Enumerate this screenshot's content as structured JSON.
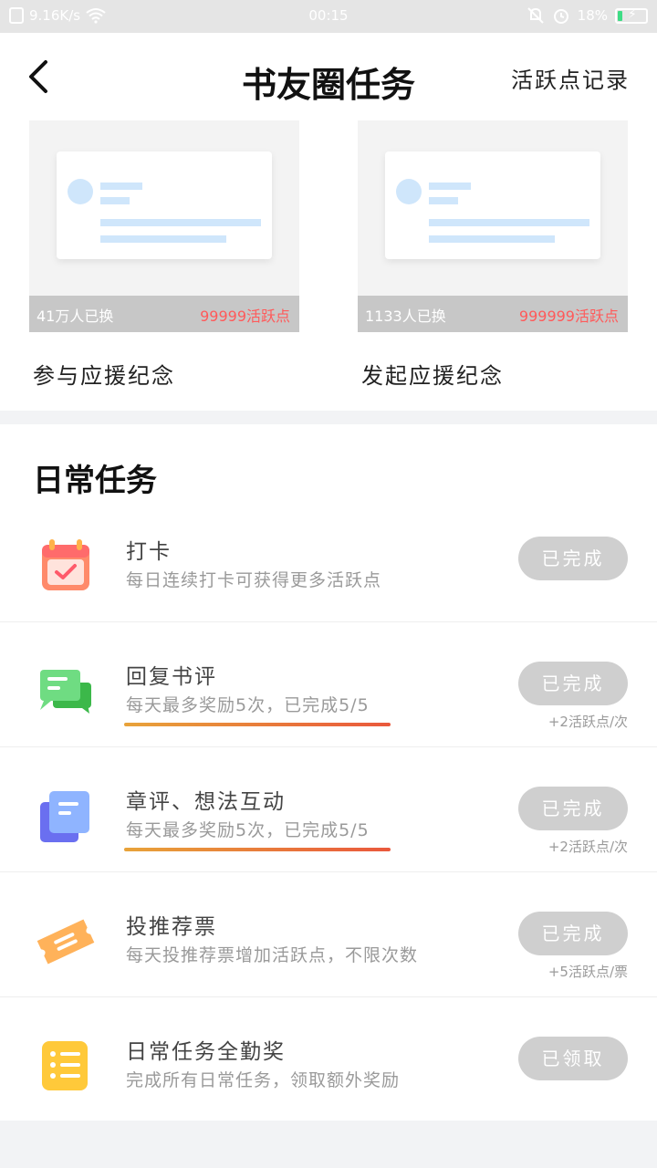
{
  "status_bar": {
    "net_speed": "9.16K/s",
    "time": "00:15",
    "battery": "18%",
    "battery_level": 0.18,
    "icons": [
      "sim-icon",
      "wifi-icon",
      "mute-icon",
      "alarm-icon",
      "battery-icon"
    ]
  },
  "header": {
    "title": "书友圈任务",
    "right_link": "活跃点记录"
  },
  "badges": [
    {
      "count": "41万人已换",
      "price": "99999活跃点",
      "name": "参与应援纪念"
    },
    {
      "count": "1133人已换",
      "price": "999999活跃点",
      "name": "发起应援纪念"
    }
  ],
  "daily": {
    "title": "日常任务",
    "tasks": [
      {
        "icon": "calendar-check-icon",
        "title": "打卡",
        "desc": "每日连续打卡可获得更多活跃点",
        "button": "已完成",
        "reward": ""
      },
      {
        "icon": "chat-bubble-icon",
        "title": "回复书评",
        "desc": "每天最多奖励5次，已完成5/5",
        "button": "已完成",
        "reward": "+2活跃点/次"
      },
      {
        "icon": "document-icon",
        "title": "章评、想法互动",
        "desc": "每天最多奖励5次，已完成5/5",
        "button": "已完成",
        "reward": "+2活跃点/次"
      },
      {
        "icon": "ticket-icon",
        "title": "投推荐票",
        "desc": "每天投推荐票增加活跃点，不限次数",
        "button": "已完成",
        "reward": "+5活跃点/票"
      },
      {
        "icon": "list-icon",
        "title": "日常任务全勤奖",
        "desc": "完成所有日常任务，领取额外奖励",
        "button": "已领取",
        "reward": ""
      }
    ]
  },
  "colors": {
    "accent_red": "#ff5a5a",
    "button_done": "#cfcfcf",
    "underline_start": "#e8a33a",
    "underline_end": "#e9583c"
  }
}
